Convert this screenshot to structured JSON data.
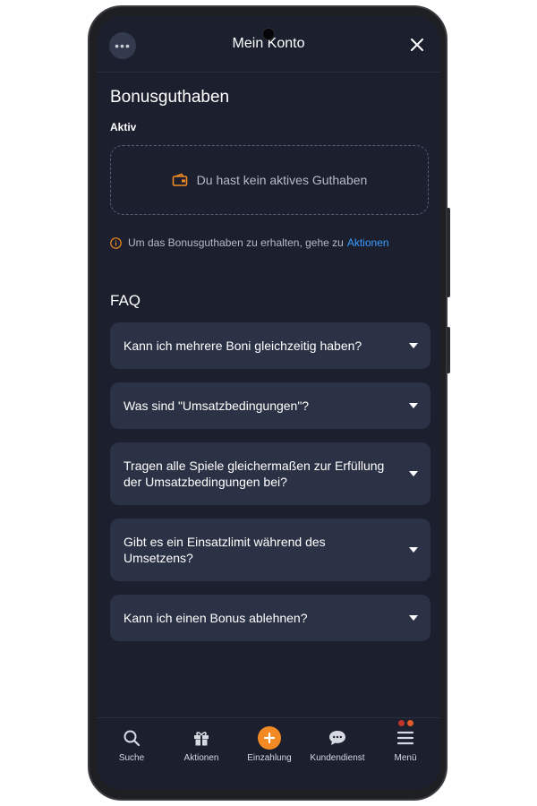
{
  "header": {
    "title": "Mein Konto",
    "menu_icon": "ellipsis-icon",
    "close_icon": "close-icon"
  },
  "bonus": {
    "heading": "Bonusguthaben",
    "active_label": "Aktiv",
    "empty_text": "Du hast kein aktives Guthaben",
    "info_text": "Um das Bonusguthaben zu erhalten, gehe zu",
    "info_link": "Aktionen"
  },
  "faq": {
    "heading": "FAQ",
    "items": [
      {
        "question": "Kann ich mehrere Boni gleichzeitig haben?"
      },
      {
        "question": "Was sind \"Umsatzbedingungen\"?"
      },
      {
        "question": "Tragen alle Spiele gleichermaßen zur Erfüllung der Umsatzbedingungen bei?"
      },
      {
        "question": "Gibt es ein Einsatzlimit während des Umsetzens?"
      },
      {
        "question": "Kann ich einen Bonus ablehnen?"
      }
    ]
  },
  "nav": {
    "items": [
      {
        "label": "Suche",
        "icon": "search-icon"
      },
      {
        "label": "Aktionen",
        "icon": "gift-icon"
      },
      {
        "label": "Einzahlung",
        "icon": "plus-circle-icon"
      },
      {
        "label": "Kundendienst",
        "icon": "chat-bubble-icon"
      },
      {
        "label": "Menü",
        "icon": "hamburger-icon"
      }
    ]
  },
  "colors": {
    "background": "#1b1f2e",
    "card": "#2c3245",
    "accent_orange": "#f28a24",
    "link_blue": "#3a9cff"
  }
}
